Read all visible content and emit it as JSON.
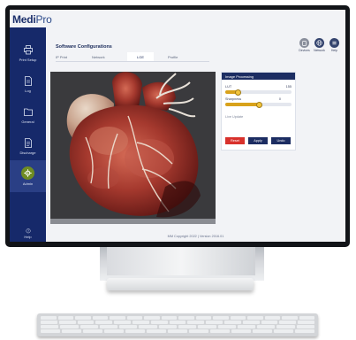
{
  "app": {
    "logo_main": "Medi",
    "logo_sub": "Pro",
    "title": "Software Configurations"
  },
  "tabs": [
    "IP Print",
    "Network",
    "LGE",
    "Profile"
  ],
  "active_tab": "LGE",
  "top_icons": [
    {
      "label": "Devices",
      "icon": "device-icon"
    },
    {
      "label": "Network",
      "icon": "globe-icon"
    },
    {
      "label": "Help",
      "icon": "help-icon"
    }
  ],
  "sidebar": [
    {
      "label": "Print Setup",
      "icon": "printer-icon"
    },
    {
      "label": "Log",
      "icon": "document-icon"
    },
    {
      "label": "General",
      "icon": "folder-icon"
    },
    {
      "label": "Discharge",
      "icon": "file-icon"
    },
    {
      "label": "Admin",
      "icon": "gear-icon",
      "active": true
    },
    {
      "label": "Help",
      "icon": "help-icon"
    }
  ],
  "panel": {
    "title": "Image Processing",
    "row1_label": "LUT",
    "row1_value": "155",
    "row1_level": 0.18,
    "row2_label": "Sharpness",
    "row2_value": "0",
    "row2_level": 0.5,
    "link": "Live Update",
    "btn1": "Reset",
    "btn2": "Apply",
    "btn3": "Undo"
  },
  "footer": "MM Copyright 2022 | Version 2016.01",
  "colors": {
    "brand_navy": "#16296a",
    "accent_gold": "#d8a21b",
    "danger_red": "#d8312c",
    "admin_green": "#6f8c23"
  }
}
